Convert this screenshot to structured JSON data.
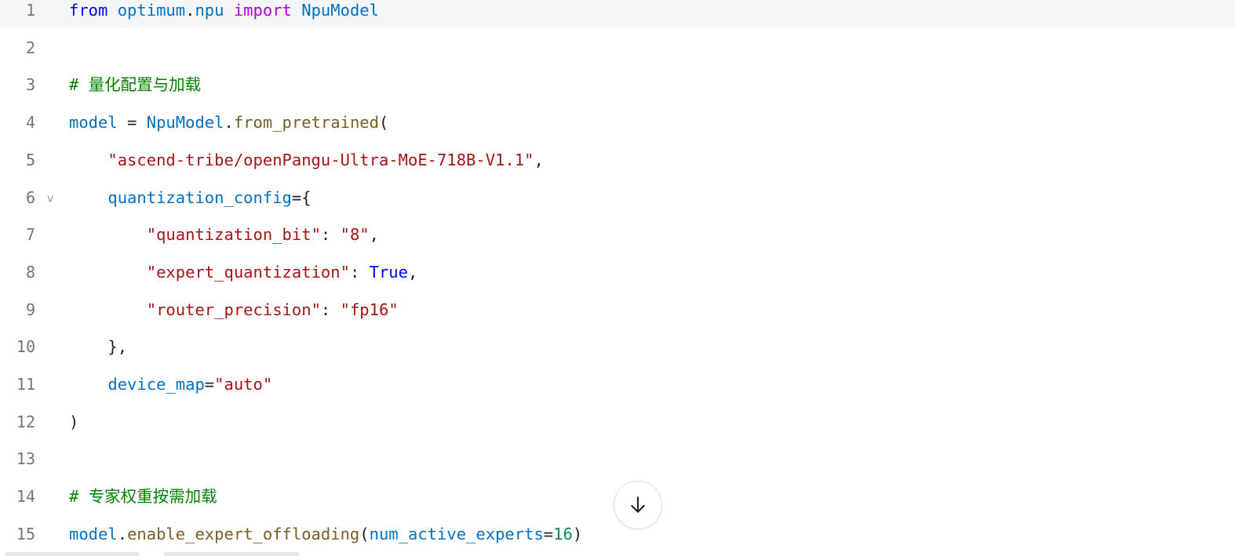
{
  "editor": {
    "lines": [
      {
        "num": "1",
        "tokens": [
          {
            "t": "from",
            "c": "kw"
          },
          {
            "t": " ",
            "c": "op"
          },
          {
            "t": "optimum",
            "c": "mod"
          },
          {
            "t": ".",
            "c": "op"
          },
          {
            "t": "npu",
            "c": "mod"
          },
          {
            "t": " ",
            "c": "op"
          },
          {
            "t": "import",
            "c": "kw2"
          },
          {
            "t": " ",
            "c": "op"
          },
          {
            "t": "NpuModel",
            "c": "cls"
          }
        ]
      },
      {
        "num": "2",
        "tokens": []
      },
      {
        "num": "3",
        "tokens": [
          {
            "t": "# ",
            "c": "cmt"
          },
          {
            "t": "量化配置与加载",
            "c": "cmt cmt-cjk"
          }
        ]
      },
      {
        "num": "4",
        "tokens": [
          {
            "t": "model",
            "c": "var"
          },
          {
            "t": " = ",
            "c": "op"
          },
          {
            "t": "NpuModel",
            "c": "cls"
          },
          {
            "t": ".",
            "c": "op"
          },
          {
            "t": "from_pretrained",
            "c": "fn"
          },
          {
            "t": "(",
            "c": "op"
          }
        ]
      },
      {
        "num": "5",
        "tokens": [
          {
            "t": "    ",
            "c": "op"
          },
          {
            "t": "\"ascend-tribe/openPangu-Ultra-MoE-718B-V1.1\"",
            "c": "str"
          },
          {
            "t": ",",
            "c": "op"
          }
        ]
      },
      {
        "num": "6",
        "fold": "v",
        "tokens": [
          {
            "t": "    ",
            "c": "op"
          },
          {
            "t": "quantization_config",
            "c": "var"
          },
          {
            "t": "={",
            "c": "op"
          }
        ]
      },
      {
        "num": "7",
        "tokens": [
          {
            "t": "        ",
            "c": "op"
          },
          {
            "t": "\"quantization_bit\"",
            "c": "str"
          },
          {
            "t": ": ",
            "c": "op"
          },
          {
            "t": "\"8\"",
            "c": "str"
          },
          {
            "t": ",",
            "c": "op"
          }
        ]
      },
      {
        "num": "8",
        "tokens": [
          {
            "t": "        ",
            "c": "op"
          },
          {
            "t": "\"expert_quantization\"",
            "c": "str"
          },
          {
            "t": ": ",
            "c": "op"
          },
          {
            "t": "True",
            "c": "kw"
          },
          {
            "t": ",",
            "c": "op"
          }
        ]
      },
      {
        "num": "9",
        "tokens": [
          {
            "t": "        ",
            "c": "op"
          },
          {
            "t": "\"router_precision\"",
            "c": "str"
          },
          {
            "t": ": ",
            "c": "op"
          },
          {
            "t": "\"fp16\"",
            "c": "str"
          }
        ]
      },
      {
        "num": "10",
        "tokens": [
          {
            "t": "    ",
            "c": "op"
          },
          {
            "t": "},",
            "c": "op"
          }
        ]
      },
      {
        "num": "11",
        "tokens": [
          {
            "t": "    ",
            "c": "op"
          },
          {
            "t": "device_map",
            "c": "var"
          },
          {
            "t": "=",
            "c": "op"
          },
          {
            "t": "\"auto\"",
            "c": "str"
          }
        ]
      },
      {
        "num": "12",
        "tokens": [
          {
            "t": ")",
            "c": "op"
          }
        ]
      },
      {
        "num": "13",
        "tokens": []
      },
      {
        "num": "14",
        "tokens": [
          {
            "t": "# ",
            "c": "cmt"
          },
          {
            "t": "专家权重按需加载",
            "c": "cmt cmt-cjk"
          }
        ]
      },
      {
        "num": "15",
        "tokens": [
          {
            "t": "model",
            "c": "var"
          },
          {
            "t": ".",
            "c": "op"
          },
          {
            "t": "enable_expert_offloading",
            "c": "fn"
          },
          {
            "t": "(",
            "c": "op"
          },
          {
            "t": "num_active_experts",
            "c": "var"
          },
          {
            "t": "=",
            "c": "op"
          },
          {
            "t": "16",
            "c": "num"
          },
          {
            "t": ")",
            "c": "op"
          }
        ]
      }
    ],
    "active_line": "1"
  },
  "controls": {
    "scroll_down_icon": "arrow-down-icon"
  },
  "colors": {
    "keyword": "#0000ff",
    "import_keyword": "#af00db",
    "identifier": "#0070c1",
    "function": "#795e26",
    "string": "#a31515",
    "number": "#098658",
    "comment": "#008000",
    "line_number": "#6e7781",
    "active_line_bg": "#f5f6f7"
  }
}
